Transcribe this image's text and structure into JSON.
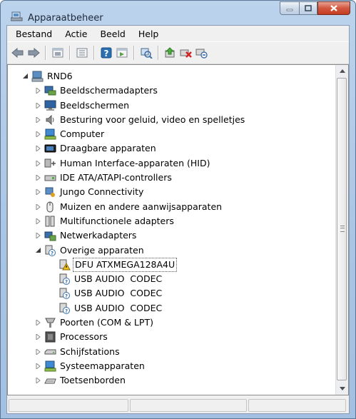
{
  "window": {
    "title": "Apparaatbeheer"
  },
  "menu": [
    "Bestand",
    "Actie",
    "Beeld",
    "Help"
  ],
  "toolbar": {
    "icons": [
      "back-icon",
      "forward-icon",
      "properties-view-icon",
      "list-view-icon",
      "help-icon",
      "console-tree-icon",
      "scan-hardware-icon",
      "update-driver-icon",
      "uninstall-icon",
      "disable-icon"
    ]
  },
  "tree": {
    "root": "RND6",
    "items": [
      {
        "label": "Beeldschermadapters",
        "icon": "display-adapter-icon"
      },
      {
        "label": "Beeldschermen",
        "icon": "monitor-icon"
      },
      {
        "label": "Besturing voor geluid, video en spelletjes",
        "icon": "speaker-icon"
      },
      {
        "label": "Computer",
        "icon": "computer-icon"
      },
      {
        "label": "Draagbare apparaten",
        "icon": "portable-device-icon"
      },
      {
        "label": "Human Interface-apparaten (HID)",
        "icon": "hid-icon"
      },
      {
        "label": "IDE ATA/ATAPI-controllers",
        "icon": "ide-controller-icon"
      },
      {
        "label": "Jungo Connectivity",
        "icon": "jungo-icon"
      },
      {
        "label": "Muizen en andere aanwijsapparaten",
        "icon": "mouse-icon"
      },
      {
        "label": "Multifunctionele adapters",
        "icon": "multifunction-adapter-icon"
      },
      {
        "label": "Netwerkadapters",
        "icon": "network-adapter-icon"
      },
      {
        "label": "Overige apparaten",
        "icon": "unknown-device-icon",
        "expanded": true,
        "children": [
          {
            "label": "DFU ATXMEGA128A4U",
            "icon": "warning-device-icon",
            "selected": true
          },
          {
            "label": "USB AUDIO  CODEC",
            "icon": "unknown-device-icon"
          },
          {
            "label": "USB AUDIO  CODEC",
            "icon": "unknown-device-icon"
          },
          {
            "label": "USB AUDIO  CODEC",
            "icon": "unknown-device-icon"
          }
        ]
      },
      {
        "label": "Poorten (COM & LPT)",
        "icon": "port-icon"
      },
      {
        "label": "Processors",
        "icon": "processor-icon"
      },
      {
        "label": "Schijfstations",
        "icon": "disk-drive-icon"
      },
      {
        "label": "Systeemapparaten",
        "icon": "system-device-icon"
      },
      {
        "label": "Toetsenborden",
        "icon": "keyboard-icon"
      }
    ]
  },
  "colors": {
    "accent": "#2a6fb0",
    "close": "#c43d22"
  }
}
